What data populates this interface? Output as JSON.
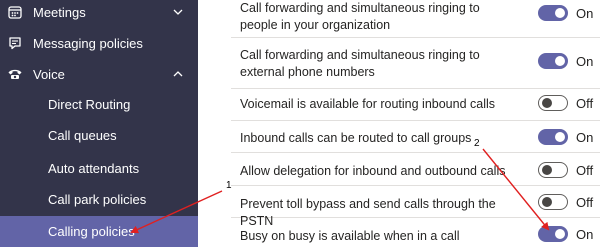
{
  "sidebar": {
    "meetings": "Meetings",
    "messaging": "Messaging policies",
    "voice": "Voice",
    "sub_items": [
      "Direct Routing",
      "Call queues",
      "Auto attendants",
      "Call park policies",
      "Calling policies"
    ],
    "active_item": "Calling policies"
  },
  "settings": [
    {
      "text": "Call forwarding and simultaneous ringing to people in your organization",
      "state": "On"
    },
    {
      "text": "Call forwarding and simultaneous ringing to external phone numbers",
      "state": "On"
    },
    {
      "text": "Voicemail is available for routing inbound calls",
      "state": "Off"
    },
    {
      "text": "Inbound calls can be routed to call groups",
      "state": "On"
    },
    {
      "text": "Allow delegation for inbound and outbound calls",
      "state": "Off"
    },
    {
      "text": "Prevent toll bypass and send calls through the PSTN",
      "state": "Off"
    },
    {
      "text": "Busy on busy is available when in a call",
      "state": "On"
    }
  ],
  "annotations": {
    "first": "1",
    "second": "2"
  },
  "colors": {
    "sidebar_bg": "#33344a",
    "active_bg": "#6264a7",
    "toggle_on": "#6264a7",
    "arrow": "#e02020"
  },
  "icons": [
    "calendar-icon",
    "message-icon",
    "phone-icon",
    "chevron-down-icon",
    "chevron-up-icon"
  ]
}
